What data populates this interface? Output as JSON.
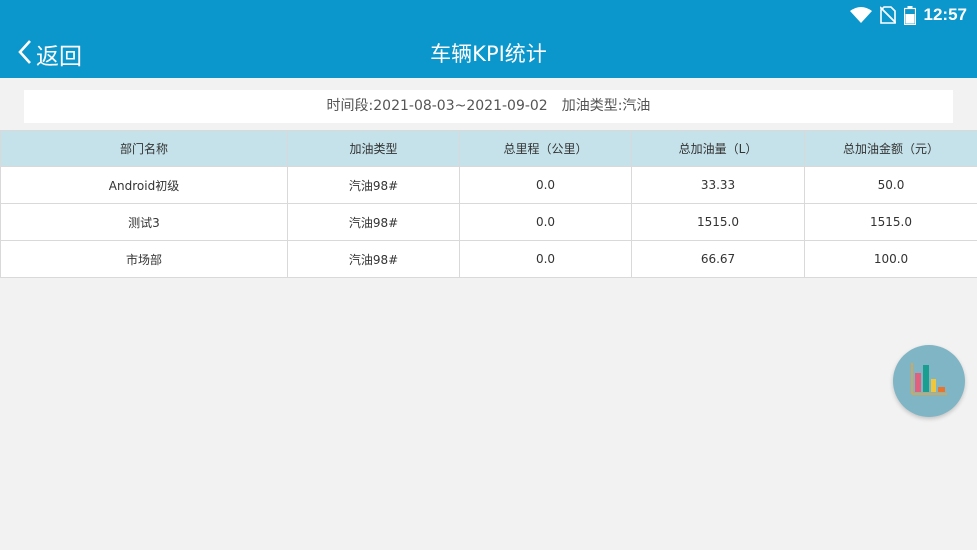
{
  "status_bar": {
    "time": "12:57",
    "icons": [
      "wifi-icon",
      "no-sim-icon",
      "battery-icon"
    ]
  },
  "header": {
    "back_label": "返回",
    "title": "车辆KPI统计"
  },
  "filter": {
    "period": "时间段:2021-08-03~2021-09-02",
    "fuel_type": "加油类型:汽油"
  },
  "table": {
    "columns": [
      "部门名称",
      "加油类型",
      "总里程（公里）",
      "总加油量（L）",
      "总加油金额（元）"
    ],
    "rows": [
      [
        "Android初级",
        "汽油98#",
        "0.0",
        "33.33",
        "50.0"
      ],
      [
        "测试3",
        "汽油98#",
        "0.0",
        "1515.0",
        "1515.0"
      ],
      [
        "市场部",
        "汽油98#",
        "0.0",
        "66.67",
        "100.0"
      ]
    ]
  },
  "fab": {
    "icon": "bar-chart-icon"
  },
  "colors": {
    "primary": "#0b96cc",
    "header_row": "#c5e2ea",
    "background": "#f2f2f2",
    "fab": "#7fb5c4"
  }
}
